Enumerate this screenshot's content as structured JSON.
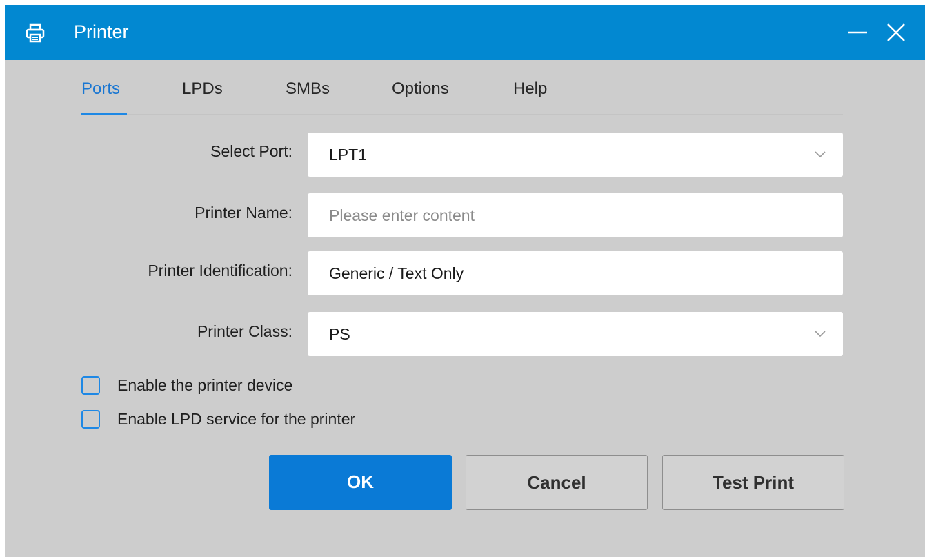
{
  "window": {
    "title": "Printer"
  },
  "tabs": [
    {
      "label": "Ports",
      "active": true
    },
    {
      "label": "LPDs",
      "active": false
    },
    {
      "label": "SMBs",
      "active": false
    },
    {
      "label": "Options",
      "active": false
    },
    {
      "label": "Help",
      "active": false
    }
  ],
  "form": {
    "select_port": {
      "label": "Select Port:",
      "value": "LPT1"
    },
    "printer_name": {
      "label": "Printer Name:",
      "value": "",
      "placeholder": "Please enter content"
    },
    "printer_identification": {
      "label": "Printer Identification:",
      "value": "Generic / Text Only"
    },
    "printer_class": {
      "label": "Printer Class:",
      "value": "PS"
    }
  },
  "checkboxes": [
    {
      "label": "Enable the printer device",
      "checked": false
    },
    {
      "label": "Enable LPD service for the printer",
      "checked": false
    }
  ],
  "buttons": {
    "ok": "OK",
    "cancel": "Cancel",
    "test_print": "Test Print"
  },
  "icons": {
    "title": "printer-icon",
    "minimize": "minimize-icon",
    "close": "close-icon",
    "dropdown": "chevron-down-icon"
  },
  "colors": {
    "titlebar": "#0288d1",
    "accent": "#1e88e5",
    "primary_button": "#0a7ad6",
    "background": "#cdcdcd"
  }
}
